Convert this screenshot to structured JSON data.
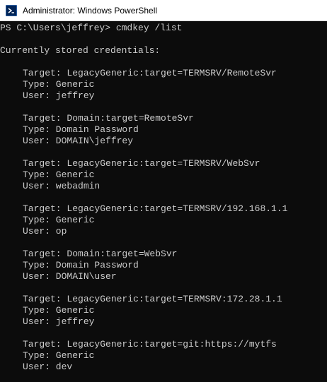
{
  "window": {
    "title": "Administrator: Windows PowerShell",
    "icon": "powershell-icon"
  },
  "console": {
    "prompt": "PS C:\\Users\\jeffrey> ",
    "command": "cmdkey /list",
    "header": "Currently stored credentials:",
    "credentials": [
      {
        "target": "Target: LegacyGeneric:target=TERMSRV/RemoteSvr",
        "type": "Type: Generic",
        "user": "User: jeffrey"
      },
      {
        "target": "Target: Domain:target=RemoteSvr",
        "type": "Type: Domain Password",
        "user": "User: DOMAIN\\jeffrey"
      },
      {
        "target": "Target: LegacyGeneric:target=TERMSRV/WebSvr",
        "type": "Type: Generic",
        "user": "User: webadmin"
      },
      {
        "target": "Target: LegacyGeneric:target=TERMSRV/192.168.1.1",
        "type": "Type: Generic",
        "user": "User: op"
      },
      {
        "target": "Target: Domain:target=WebSvr",
        "type": "Type: Domain Password",
        "user": "User: DOMAIN\\user"
      },
      {
        "target": "Target: LegacyGeneric:target=TERMSRV:172.28.1.1",
        "type": "Type: Generic",
        "user": "User: jeffrey"
      },
      {
        "target": "Target: LegacyGeneric:target=git:https://mytfs",
        "type": "Type: Generic",
        "user": "User: dev"
      }
    ]
  },
  "colors": {
    "background": "#0c0c0c",
    "text": "#cccccc",
    "titlebar": "#ffffff"
  }
}
